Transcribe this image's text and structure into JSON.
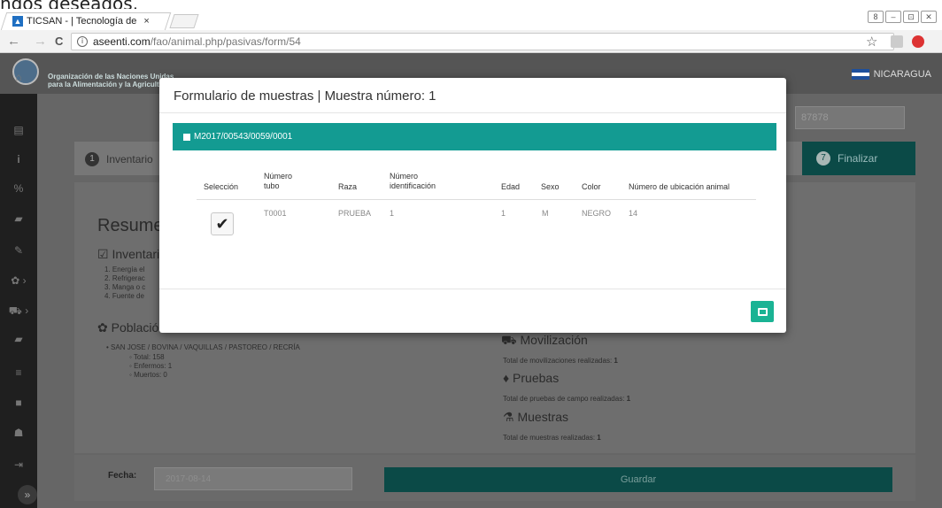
{
  "caption_partial": "ngos deseados.",
  "browser": {
    "tab_title": "TICSAN - | Tecnología de",
    "tab_close": "×",
    "url_host": "aseenti.com",
    "url_path": "/fao/animal.php/pasivas/form/54",
    "back": "←",
    "forward": "→",
    "reload": "C",
    "star": "☆",
    "info": "i",
    "window_buttons": [
      "8",
      "–",
      "⊡",
      "✕"
    ]
  },
  "header": {
    "org_line1": "Organización de las Naciones Unidas",
    "org_line2": "para la Alimentación y la Agricultura",
    "country": "NICARAGUA"
  },
  "sidebar": {
    "icons": [
      "home-icon",
      "file-icon",
      "info-icon",
      "percent-icon",
      "book-icon",
      "edit-icon",
      "paw-icon",
      "truck-icon",
      "cow-icon",
      "list-icon",
      "folder-icon",
      "users-icon",
      "logout-icon"
    ],
    "glyphs": [
      "⌂",
      "▤",
      "i",
      "%",
      "▰",
      "✎",
      "✿ ›",
      "⛟ ›",
      "▰",
      "≡",
      "■",
      "☗",
      "⇥"
    ],
    "toggle": "»"
  },
  "page": {
    "code_value": "87878",
    "step_inventory_num": "1",
    "step_inventory_label": "Inventario",
    "step_finalize_num": "7",
    "step_finalize_label": "Finalizar",
    "resumen_title": "Resumen",
    "inventario_title": "☑ Inventario",
    "inventario_items": [
      "1. Energía el",
      "2. Refrigerac",
      "3. Manga o c",
      "4. Fuente de"
    ],
    "poblacion_title": "Población",
    "poblacion_entry": "SAN JOSE / BOVINA / VAQUILLAS / PASTOREO / RECRÍA",
    "poblacion_stats": [
      "Total: 158",
      "Enfermos: 1",
      "Muertos: 0"
    ],
    "movilizacion_title": "Movilización",
    "movilizacion_text": "Total de movilizaciones realizadas:",
    "movilizacion_value": "1",
    "pruebas_title": "Pruebas",
    "pruebas_text": "Total de pruebas de campo realizadas:",
    "pruebas_value": "1",
    "muestras_title": "Muestras",
    "muestras_text": "Total de muestras realizadas:",
    "muestras_value": "1",
    "fecha_label": "Fecha:",
    "fecha_value": "2017-08-14",
    "save_label": "Guardar"
  },
  "modal": {
    "title": "Formulario de muestras | Muestra número: 1",
    "panel_title": "M2017/00543/0059/0001",
    "columns": [
      "Selección",
      "Número tubo",
      "Raza",
      "Número identificación",
      "Edad",
      "Sexo",
      "Color",
      "Número de ubicación animal"
    ],
    "row": {
      "selected": true,
      "check": "✔",
      "tubo": "T0001",
      "raza": "PRUEBA",
      "identificacion": "1",
      "edad": "1",
      "sexo": "M",
      "color": "NEGRO",
      "ubicacion": "14"
    }
  },
  "colors": {
    "teal_panel": "#139b92",
    "action_button": "#1ab394",
    "overlay": "rgba(0,0,0,0.6)"
  }
}
